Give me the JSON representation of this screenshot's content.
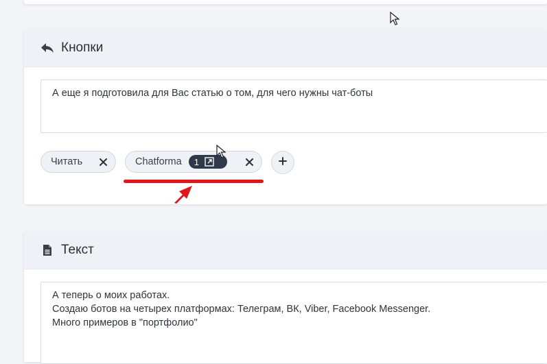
{
  "buttons_section": {
    "title": "Кнопки",
    "message_text": "А еще я подготовила для Вас статью о том, для чего нужны чат-боты",
    "chips": [
      {
        "label": "Читать"
      },
      {
        "label": "Chatforma",
        "count": "1"
      }
    ]
  },
  "text_section": {
    "title": "Текст",
    "lines": [
      "А теперь о моих работах.",
      "Создаю ботов на четырех платформах: Телеграм, ВК, Viber, Facebook Messenger.",
      "Много примеров в \"портфолио\""
    ]
  },
  "colors": {
    "annotation": "#e1161b",
    "counter_badge": "#2e3a4a",
    "header_bg": "#eef1f6"
  },
  "icons": [
    "reply-icon",
    "close-icon",
    "external-link-icon",
    "plus-icon",
    "document-icon",
    "mouse-cursor-icon",
    "annotation-arrow-icon"
  ]
}
